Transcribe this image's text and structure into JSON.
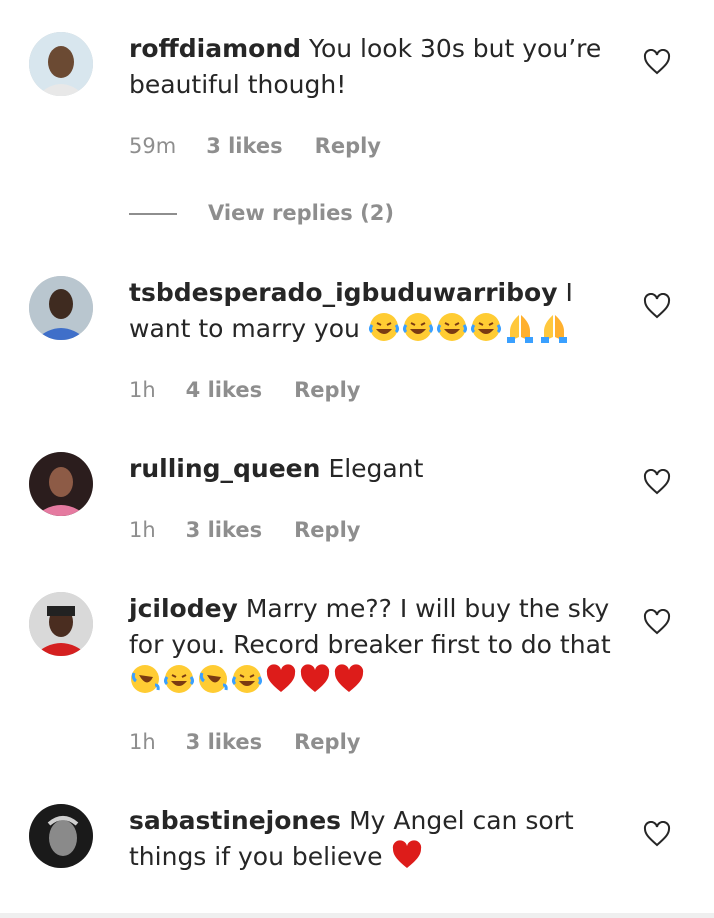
{
  "comments": [
    {
      "username": "roffdiamond",
      "text": "You look 30s but you’re beautiful though!",
      "emojis": [],
      "time": "59m",
      "likes": "3 likes",
      "reply": "Reply"
    },
    {
      "username": "tsbdesperado_igbuduwarriboy",
      "text": "I want to marry you",
      "emojis": [
        "laughing-tears",
        "laughing-tears",
        "laughing-tears",
        "laughing-tears",
        "folded-hands",
        "folded-hands"
      ],
      "time": "1h",
      "likes": "4 likes",
      "reply": "Reply"
    },
    {
      "username": "rulling_queen",
      "text": "Elegant",
      "emojis": [],
      "time": "1h",
      "likes": "3 likes",
      "reply": "Reply"
    },
    {
      "username": "jcilodey",
      "text": "Marry me?? I will buy the sky for you. Record breaker first to do that",
      "emojis": [
        "rofl",
        "laughing-tears",
        "rofl",
        "laughing-tears",
        "red-heart",
        "red-heart",
        "red-heart"
      ],
      "time": "1h",
      "likes": "3 likes",
      "reply": "Reply"
    },
    {
      "username": "sabastinejones",
      "text": "My Angel can sort things if you believe",
      "emojis": [
        "red-heart"
      ],
      "time": "",
      "likes": "",
      "reply": ""
    }
  ],
  "view_replies": "View replies (2)",
  "colors": {
    "text": "#262626",
    "meta": "#8e8e8e",
    "heart_stroke": "#262626",
    "emoji_yellow": "#ffcc33",
    "heart_red": "#dd1c1a"
  },
  "icons": {
    "like": "heart-outline-icon"
  }
}
